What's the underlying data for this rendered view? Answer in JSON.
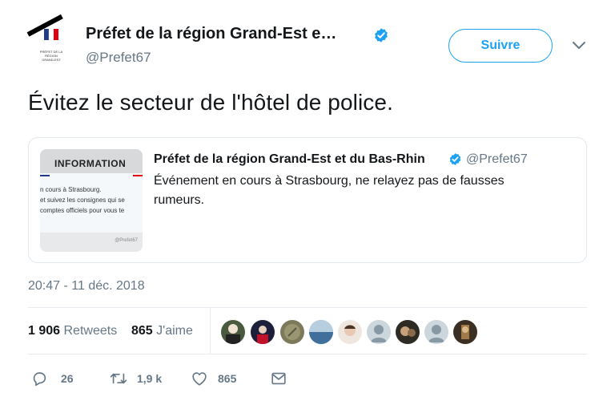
{
  "author": {
    "name": "Préfet de la région Grand-Est e…",
    "handle": "@Prefet67",
    "logo_text": "PRÉFET DE LA RÉGION GRAND-EST"
  },
  "follow_button": "Suivre",
  "tweet_text": "Évitez le secteur de l'hôtel de police.",
  "quoted": {
    "author": "Préfet de la région Grand-Est et du Bas-Rhin",
    "handle": "@Prefet67",
    "text": "Événement en cours à Strasbourg, ne relayez pas de fausses rumeurs.",
    "image": {
      "heading": "INFORMATION",
      "lines": [
        "n cours à Strasbourg.",
        "et suivez les consignes qui se",
        "comptes officiels pour vous te"
      ],
      "footer": "@Prefet67"
    }
  },
  "timestamp": "20:47 - 11 déc. 2018",
  "stats": {
    "retweets_count": "1 906",
    "retweets_label": "Retweets",
    "likes_count": "865",
    "likes_label": "J'aime"
  },
  "actions": {
    "replies": "26",
    "retweets": "1,9 k",
    "likes": "865"
  },
  "colors": {
    "accent": "#1da1f2",
    "text": "#14171a",
    "secondary": "#657786",
    "border": "#e1e8ed"
  },
  "icons": [
    "verified-badge-icon",
    "chevron-down-icon",
    "reply-icon",
    "retweet-icon",
    "like-icon",
    "message-icon"
  ]
}
